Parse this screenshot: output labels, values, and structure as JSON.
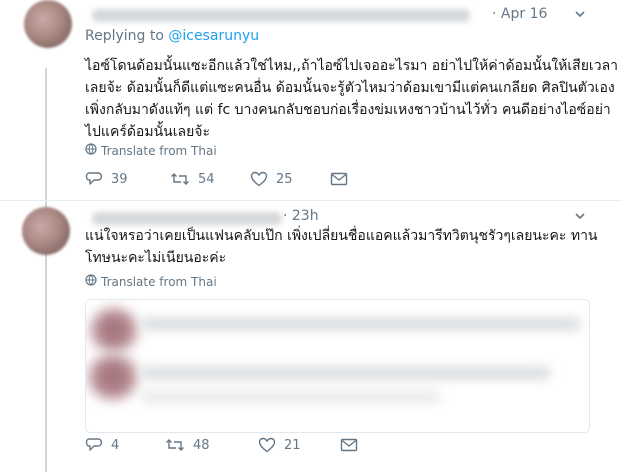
{
  "tweets": [
    {
      "date": "· Apr 16",
      "reply_prefix": "Replying to",
      "reply_handle": "@icesarunyu",
      "text_lines": [
        "ไอซ์โดนด้อมนั้นแซะอีกแล้วใช่ไหม,,ถ้าไอซ์ไปเจออะไรมา อย่าไปให้ค่าด้อมนั้นให้เสียเวลา",
        "เลยจ้ะ ด้อมนั้นก็ดีแต่แซะคนอื่น ด้อมนั้นจะรู้ตัวไหมว่าด้อมเขามีแต่คนเกลียด ศิลปินตัวเอง",
        "เพิ่งกลับมาดังแท้ๆ แต่ fc บางคนกลับชอบก่อเรื่องข่มเหงชาวบ้านไว้ทั่ว คนดีอย่างไอซ์อย่า",
        "ไปแคร์ด้อมนั้นเลยจ้ะ"
      ],
      "translate": "Translate from Thai",
      "stats": {
        "replies": "39",
        "retweets": "54",
        "likes": "25"
      }
    },
    {
      "date": "· 23h",
      "text_lines": [
        "แน่ใจหรอว่าเคยเป็นแฟนคลับเป๊ก เพิ่งเปลี่ยนชื่อแอคแล้วมารีทวิตนุชรัวๆเลยนะคะ ทาน",
        "โทษนะคะไม่เนียนอะค่ะ"
      ],
      "translate": "Translate from Thai",
      "stats": {
        "replies": "4",
        "retweets": "48",
        "likes": "21"
      }
    }
  ],
  "icons": [
    "avatar",
    "chevron-down-icon",
    "globe-icon",
    "reply-icon",
    "retweet-icon",
    "like-icon",
    "dm-icon"
  ],
  "colors": {
    "link": "#1da1f2",
    "muted": "#657786",
    "text": "#14171a",
    "divider": "#e6ecf0"
  }
}
